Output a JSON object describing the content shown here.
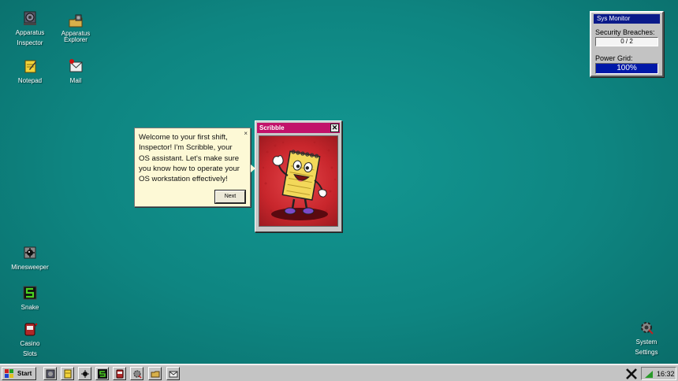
{
  "desktop": {
    "icons": [
      {
        "label_line1": "Apparatus",
        "label_line2": "Inspector",
        "icon": "apparatus-inspector-icon"
      },
      {
        "label_line1": "Apparatus",
        "label_line2": "Explorer",
        "icon": "apparatus-explorer-icon"
      },
      {
        "label_line1": "Notepad",
        "icon": "notepad-icon"
      },
      {
        "label_line1": "Mail",
        "icon": "mail-icon",
        "badge": "unread"
      },
      {
        "label_line1": "Minesweeper",
        "icon": "minesweeper-icon"
      },
      {
        "label_line1": "Snake",
        "icon": "snake-icon"
      },
      {
        "label_line1": "Casino",
        "label_line2": "Slots",
        "icon": "slot-machine-icon"
      },
      {
        "label_line1": "System",
        "label_line2": "Settings",
        "icon": "system-settings-icon"
      }
    ]
  },
  "sys_monitor": {
    "title": "Sys Monitor",
    "breaches_label": "Security Breaches:",
    "breaches_value": "0 / 2",
    "power_label": "Power Grid:",
    "power_value": "100%"
  },
  "assistant": {
    "bubble_text": "Welcome to your first shift, Inspector! I'm Scribble, your OS assistant. Let's make sure you know how to operate your OS workstation effectively!",
    "close_glyph": "×",
    "next_label": "Next",
    "window_title": "Scribble",
    "window_close_glyph": "✕"
  },
  "taskbar": {
    "start_label": "Start",
    "buttons": [
      "apparatus-inspector-icon",
      "notepad-icon",
      "minesweeper-icon",
      "snake-icon",
      "slot-machine-icon",
      "system-settings-icon",
      "apparatus-explorer-icon",
      "mail-icon"
    ],
    "clock": "16:32"
  },
  "colors": {
    "desktop": "#0f8480",
    "monitor_title": "#0a1a8a",
    "power_bar": "#0018a8",
    "scribble_title": "#c2126a",
    "bubble": "#fdf9d6"
  }
}
